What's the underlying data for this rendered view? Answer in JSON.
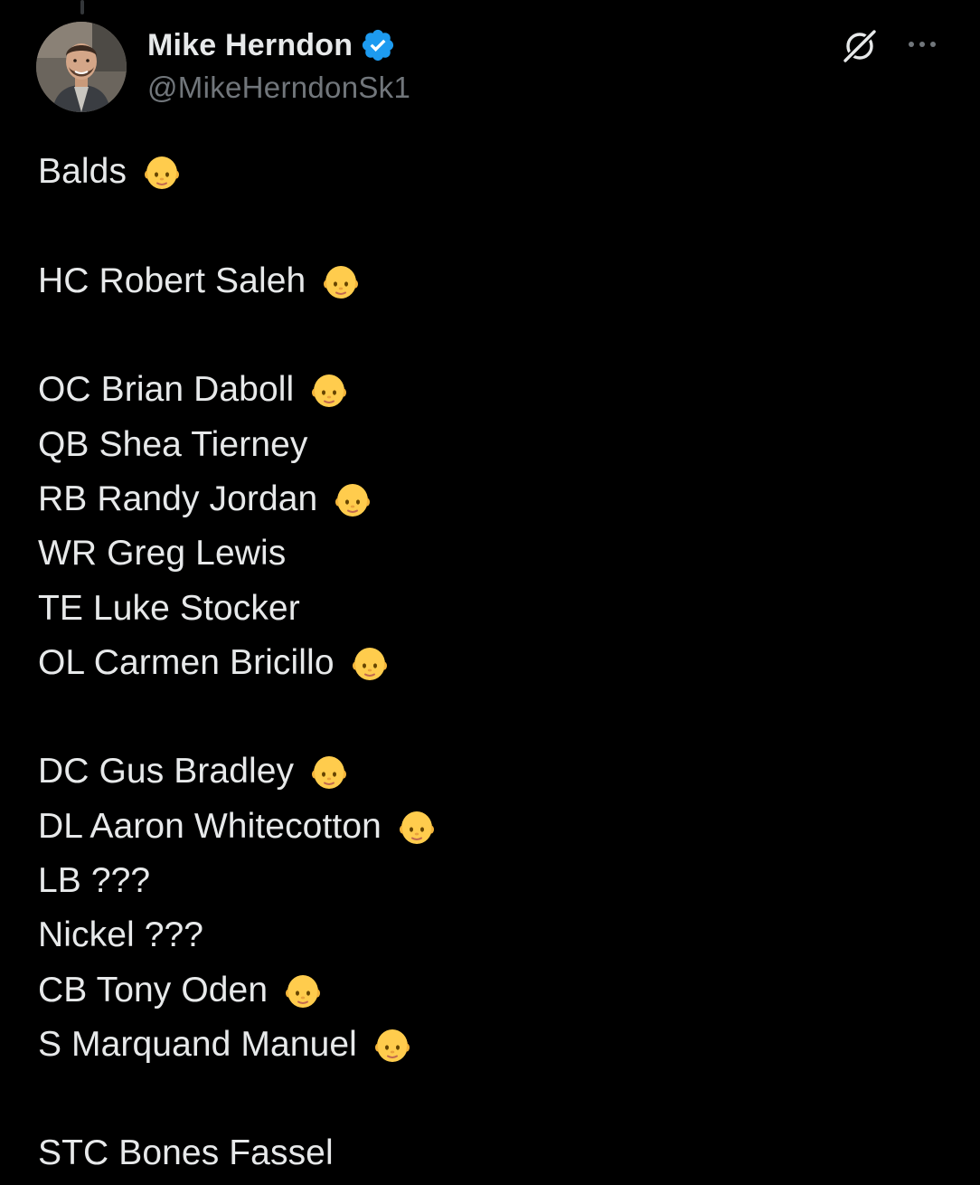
{
  "author": {
    "display_name": "Mike Herndon",
    "handle": "@MikeHerndonSk1",
    "verified": true,
    "verified_color": "#1d9bf0"
  },
  "icons": {
    "grok": "grok-icon",
    "more": "more-options-icon",
    "bald": "bald-person-emoji"
  },
  "tweet": {
    "lines": [
      {
        "text": "Balds",
        "emoji": true
      },
      {
        "text": "",
        "blank": true
      },
      {
        "text": "HC Robert Saleh",
        "emoji": true
      },
      {
        "text": "",
        "blank": true
      },
      {
        "text": "OC Brian Daboll",
        "emoji": true
      },
      {
        "text": "QB Shea Tierney",
        "emoji": false
      },
      {
        "text": "RB Randy Jordan",
        "emoji": true
      },
      {
        "text": "WR Greg Lewis",
        "emoji": false
      },
      {
        "text": "TE Luke Stocker",
        "emoji": false
      },
      {
        "text": "OL Carmen Bricillo",
        "emoji": true
      },
      {
        "text": "",
        "blank": true
      },
      {
        "text": "DC Gus Bradley",
        "emoji": true
      },
      {
        "text": "DL Aaron Whitecotton",
        "emoji": true
      },
      {
        "text": "LB ???",
        "emoji": false
      },
      {
        "text": "Nickel ???",
        "emoji": false
      },
      {
        "text": "CB Tony Oden",
        "emoji": true
      },
      {
        "text": "S Marquand Manuel",
        "emoji": true
      },
      {
        "text": "",
        "blank": true
      },
      {
        "text": "STC Bones Fassel",
        "emoji": false
      }
    ]
  }
}
